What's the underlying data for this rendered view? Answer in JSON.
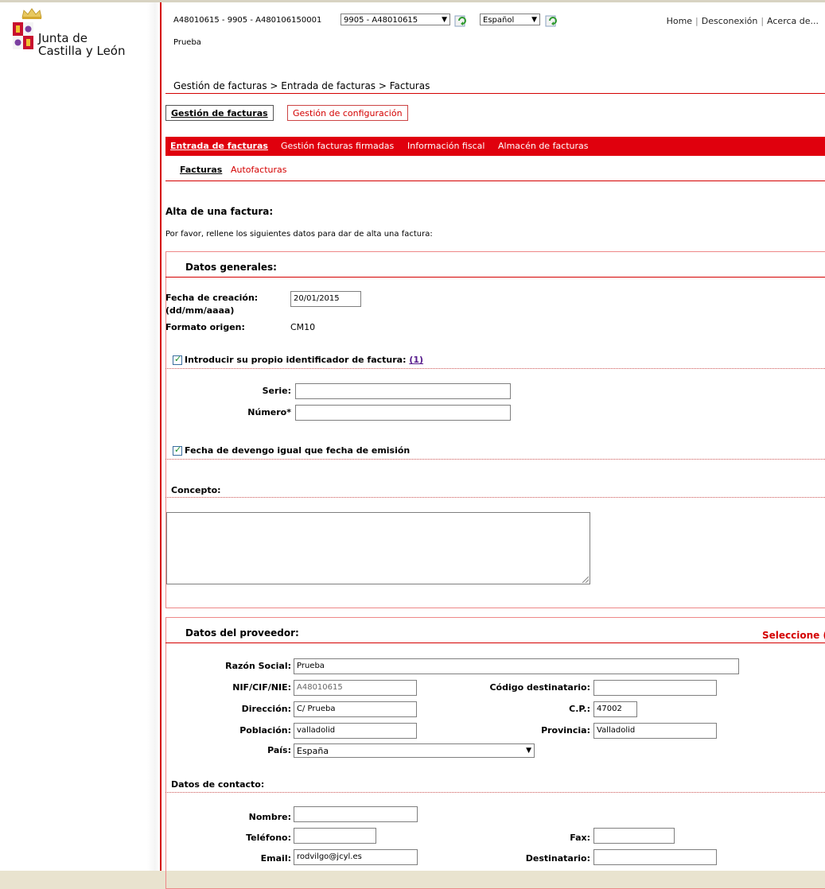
{
  "logo": {
    "line1": "Junta de",
    "line2": "Castilla y León"
  },
  "header": {
    "user_info": "A48010615 - 9905 - A480106150001",
    "org_select": "9905 - A48010615",
    "lang_select": "Español",
    "links": [
      "Home",
      "Desconexión",
      "Acerca de..."
    ],
    "prueba": "Prueba"
  },
  "breadcrumb": "Gestión de facturas > Entrada de facturas > Facturas",
  "tabs": {
    "active": "Gestión de facturas",
    "inactive": "Gestión de configuración"
  },
  "menu": [
    "Entrada de facturas",
    "Gestión facturas firmadas",
    "Información fiscal",
    "Almacén de facturas"
  ],
  "submenu": [
    "Facturas",
    "Autofacturas"
  ],
  "page": {
    "title": "Alta de una factura:",
    "description": "Por favor, rellene los siguientes datos para dar de alta una factura:"
  },
  "datos_generales": {
    "title": "Datos generales:",
    "fecha_label_1": "Fecha de creación:",
    "fecha_label_2": "(dd/mm/aaaa)",
    "fecha_value": "20/01/2015",
    "formato_label": "Formato origen:",
    "formato_value": "CM10",
    "identificador_label": "Introducir su propio identificador de factura:",
    "identificador_link": "(1)",
    "serie_label": "Serie:",
    "serie_value": "",
    "numero_label": "Número*",
    "numero_value": "",
    "devengo_label": "Fecha de devengo igual que fecha de emisión",
    "concepto_label": "Concepto:",
    "concepto_value": ""
  },
  "proveedor": {
    "title": "Datos del proveedor:",
    "seleccione": "Seleccione (",
    "razon_label": "Razón Social:",
    "razon_value": "Prueba",
    "nif_label": "NIF/CIF/NIE:",
    "nif_value": "A48010615",
    "codigo_label": "Código destinatario:",
    "codigo_value": "",
    "direccion_label": "Dirección:",
    "direccion_value": "C/ Prueba",
    "cp_label": "C.P.:",
    "cp_value": "47002",
    "poblacion_label": "Población:",
    "poblacion_value": "valladolid",
    "provincia_label": "Provincia:",
    "provincia_value": "Valladolid",
    "pais_label": "País:",
    "pais_value": "España",
    "contacto_title": "Datos de contacto:",
    "nombre_label": "Nombre:",
    "nombre_value": "",
    "telefono_label": "Teléfono:",
    "telefono_value": "",
    "fax_label": "Fax:",
    "fax_value": "",
    "email_label": "Email:",
    "email_value": "rodvilgo@jcyl.es",
    "destinatario_label": "Destinatario:",
    "destinatario_value": ""
  }
}
